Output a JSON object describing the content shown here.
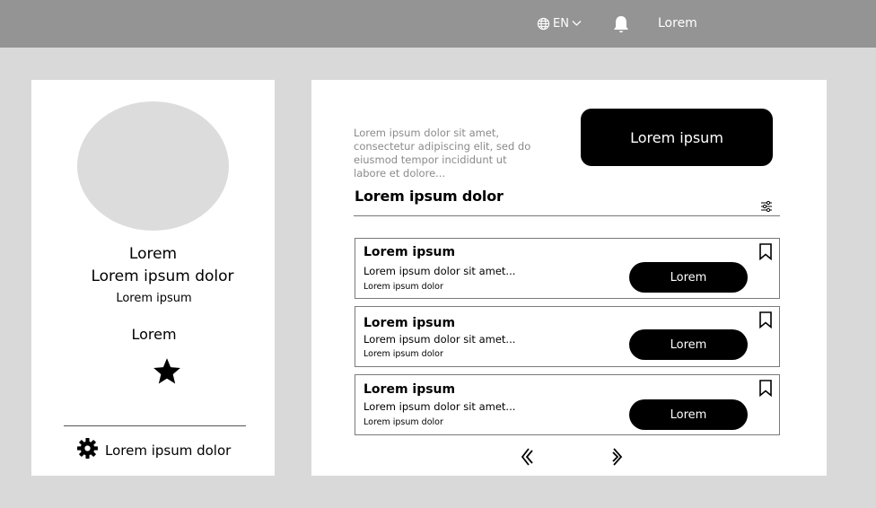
{
  "topbar": {
    "language": "EN",
    "user_label": "Lorem",
    "icons": {
      "language": "globe-icon",
      "dropdown": "chevron-down-icon",
      "notifications": "bell-icon"
    }
  },
  "profile": {
    "name": "Lorem",
    "title": "Lorem ipsum dolor",
    "subtitle": "Lorem ipsum",
    "rating_label": "Lorem",
    "rating_stars": 1,
    "settings_label": "Lorem ipsum dolor",
    "icons": {
      "rating": "star-icon",
      "settings": "gear-icon"
    }
  },
  "main": {
    "intro_text": "Lorem ipsum dolor sit amet, consectetur adipiscing elit, sed do eiusmod tempor incididunt ut labore et dolore...",
    "cta_label": "Lorem ipsum",
    "section_title": "Lorem ipsum dolor",
    "items": [
      {
        "title": "Lorem ipsum",
        "description": "Lorem ipsum dolor sit amet...",
        "meta": "Lorem ipsum dolor",
        "button": "Lorem"
      },
      {
        "title": "Lorem ipsum",
        "description": "Lorem ipsum dolor sit amet...",
        "meta": "Lorem ipsum dolor",
        "button": "Lorem"
      },
      {
        "title": "Lorem ipsum",
        "description": "Lorem ipsum dolor sit amet...",
        "meta": "Lorem ipsum dolor",
        "button": "Lorem"
      }
    ],
    "icons": {
      "filter": "sliders-icon",
      "bookmark": "bookmark-icon",
      "previous": "chevron-double-left-icon",
      "next": "chevron-right-icon"
    }
  },
  "colors": {
    "topbar": "#949494",
    "page_background": "#d9d9d9",
    "card": "#ffffff",
    "accent": "#000000",
    "avatar": "#dcdcdc"
  }
}
